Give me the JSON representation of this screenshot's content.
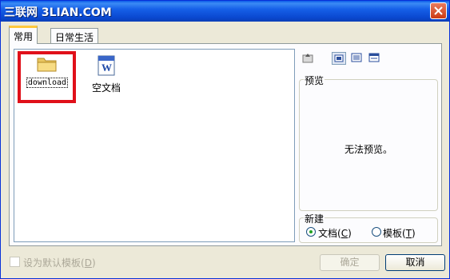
{
  "window": {
    "title": "三联网 3LIAN.COM"
  },
  "tabs": [
    {
      "label": "常用",
      "active": true
    },
    {
      "label": "日常生活",
      "active": false
    }
  ],
  "files": [
    {
      "name": "download",
      "icon": "folder-icon"
    },
    {
      "name": "空文档",
      "icon": "word-document-icon"
    }
  ],
  "preview": {
    "group_label": "预览",
    "message": "无法预览。"
  },
  "new_group": {
    "label": "新建",
    "options": [
      {
        "label": "文档",
        "hotkey": "C",
        "selected": true
      },
      {
        "label": "模板",
        "hotkey": "T",
        "selected": false
      }
    ]
  },
  "footer": {
    "default_template_label": "设为默认模板",
    "default_template_hotkey": "D",
    "ok_label": "确定",
    "cancel_label": "取消"
  }
}
